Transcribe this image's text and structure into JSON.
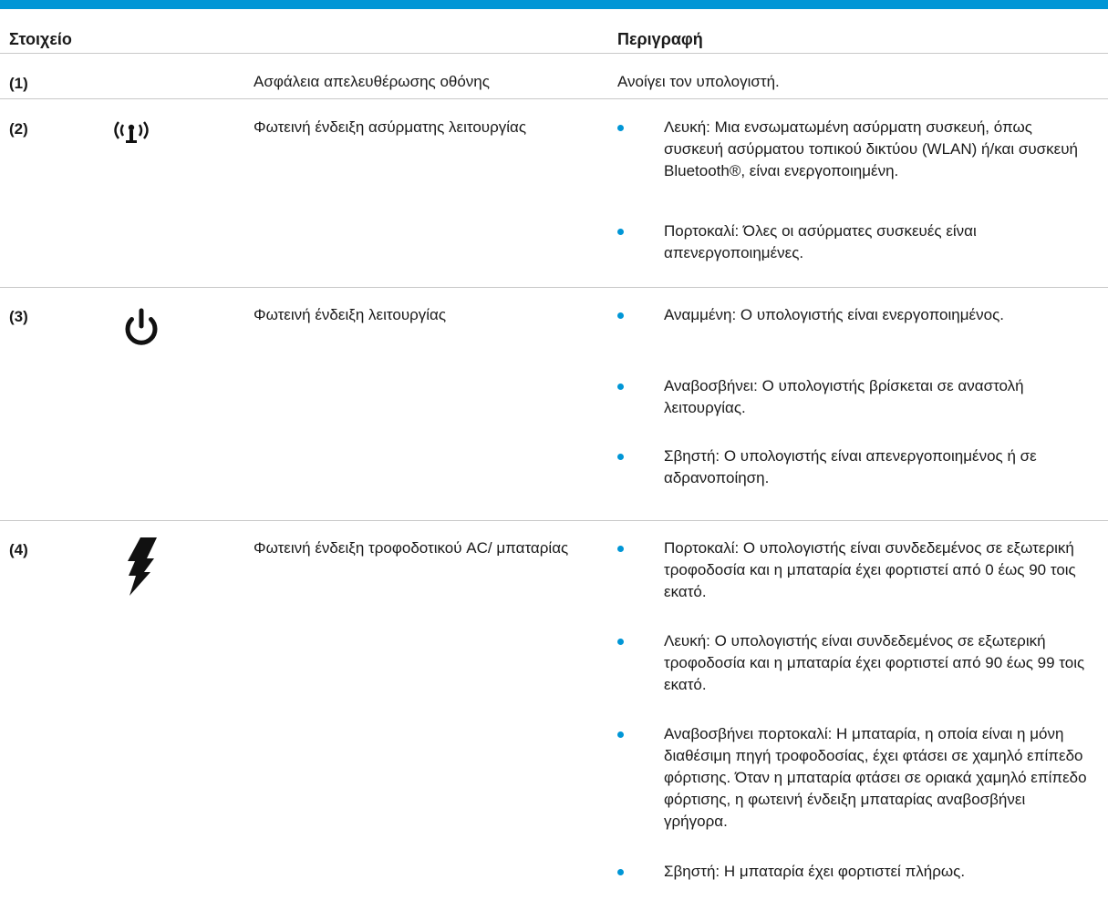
{
  "header": {
    "col_item": "Στοιχείο",
    "col_desc": "Περιγραφή"
  },
  "rows": [
    {
      "num": "(1)",
      "icon": "",
      "name": "Ασφάλεια απελευθέρωσης οθόνης",
      "desc": "Ανοίγει τον υπολογιστή."
    },
    {
      "num": "(2)",
      "icon": "wireless-icon",
      "name": "Φωτεινή ένδειξη ασύρματης λειτουργίας",
      "bullets": [
        "Λευκή: Μια ενσωματωμένη ασύρματη συσκευή, όπως συσκευή ασύρματου τοπικού δικτύου (WLAN) ή/και συσκευή Bluetooth®, είναι ενεργοποιημένη.",
        "Πορτοκαλί: Όλες οι ασύρματες συσκευές είναι απενεργοποιημένες."
      ]
    },
    {
      "num": "(3)",
      "icon": "power-icon",
      "name": "Φωτεινή ένδειξη λειτουργίας",
      "bullets": [
        "Αναμμένη: Ο υπολογιστής είναι ενεργοποιημένος.",
        "Αναβοσβήνει: Ο υπολογιστής βρίσκεται σε αναστολή λειτουργίας.",
        "Σβηστή: Ο υπολογιστής είναι απενεργοποιημένος ή σε αδρανοποίηση."
      ]
    },
    {
      "num": "(4)",
      "icon": "lightning-icon",
      "name": "Φωτεινή ένδειξη τροφοδοτικού AC/ μπαταρίας",
      "bullets": [
        "Πορτοκαλί: Ο υπολογιστής είναι συνδεδεμένος σε εξωτερική τροφοδοσία και η μπαταρία έχει φορτιστεί από 0 έως 90 τοις εκατό.",
        "Λευκή: Ο υπολογιστής είναι συνδεδεμένος σε εξωτερική τροφοδοσία και η μπαταρία έχει φορτιστεί από 90 έως 99 τοις εκατό.",
        "Αναβοσβήνει πορτοκαλί: Η μπαταρία, η οποία είναι η μόνη διαθέσιμη πηγή τροφοδοσίας, έχει φτάσει σε χαμηλό επίπεδο φόρτισης. Όταν η μπαταρία φτάσει σε οριακά χαμηλό επίπεδο φόρτισης, η φωτεινή ένδειξη μπαταρίας αναβοσβήνει γρήγορα.",
        "Σβηστή: Η μπαταρία έχει φορτιστεί πλήρως."
      ]
    }
  ],
  "colors": {
    "accent": "#0096d6",
    "rule": "#c8c8c8",
    "text": "#1a1a1a"
  }
}
